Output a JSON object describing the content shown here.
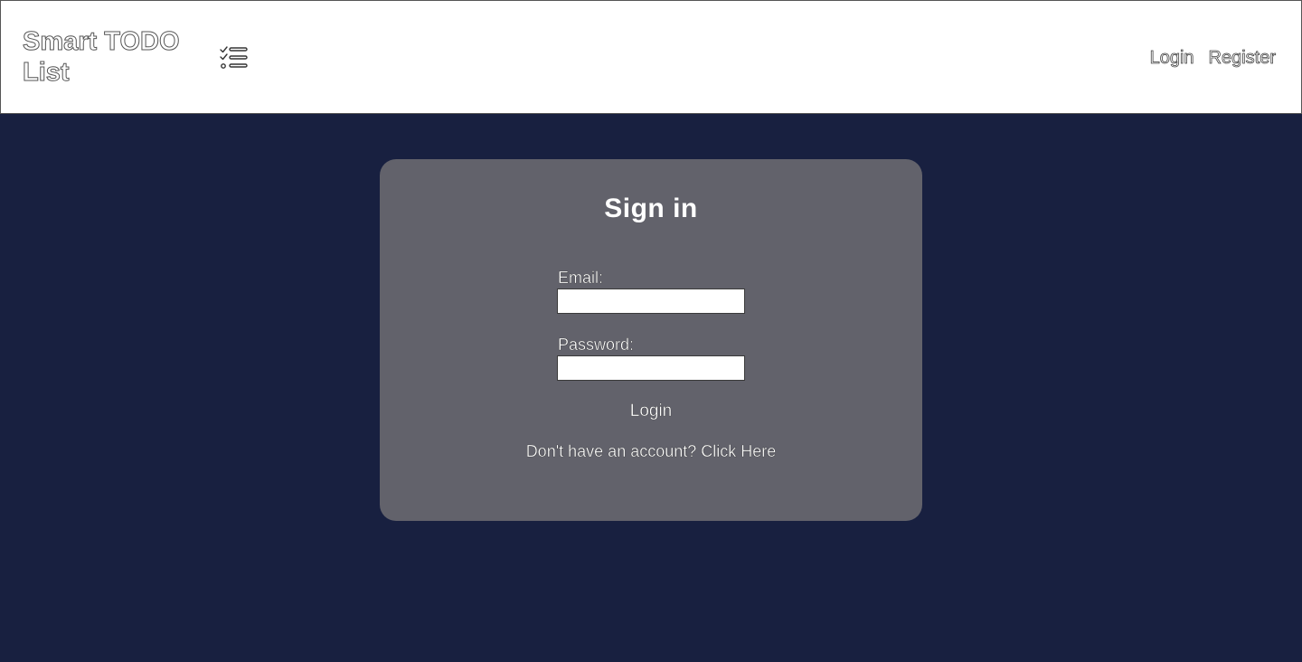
{
  "navbar": {
    "brand": "Smart TODO List",
    "brand_icon": "checklist-icon",
    "links": [
      {
        "label": "Login"
      },
      {
        "label": "Register"
      }
    ]
  },
  "login_card": {
    "title": "Sign in",
    "email_label": "Email:",
    "email_value": "",
    "password_label": "Password:",
    "password_value": "",
    "submit_label": "Login",
    "signup_prompt": "Don't have an account?",
    "signup_link": "Click Here"
  },
  "colors": {
    "page_background": "#182040",
    "navbar_background": "#ffffff",
    "card_background": "#62626b",
    "text": "#ffffff"
  }
}
